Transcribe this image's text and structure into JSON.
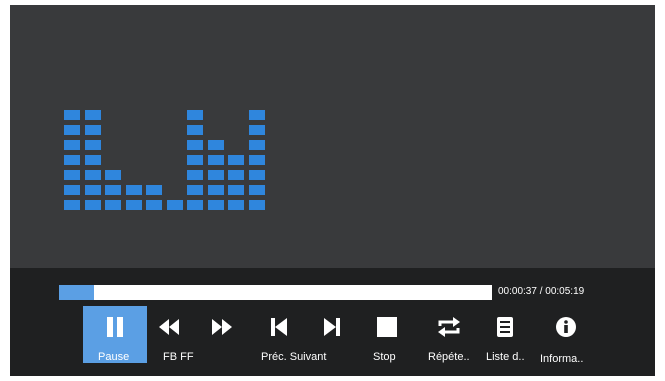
{
  "player": {
    "elapsed": "00:00:37",
    "total": "00:05:19",
    "separator": " / ",
    "progress_fraction": 0.08,
    "accent_color": "#5b9fe4",
    "visualizer_color": "#2f86dd",
    "visualizer_levels": [
      7,
      7,
      3,
      2,
      2,
      1,
      7,
      5,
      4,
      7
    ]
  },
  "controls": {
    "pause": {
      "label": "Pause",
      "icon": "pause-icon"
    },
    "rewind": {
      "icon": "rewind-icon"
    },
    "fast_forward": {
      "icon": "fast-forward-icon"
    },
    "fb_ff_label": "FB FF",
    "previous": {
      "icon": "skip-previous-icon"
    },
    "next": {
      "icon": "skip-next-icon"
    },
    "prev_next_label": "Préc. Suivant",
    "stop": {
      "label": "Stop",
      "icon": "stop-icon"
    },
    "repeat": {
      "label": "Répéte..",
      "icon": "repeat-icon"
    },
    "playlist": {
      "label": "Liste d..",
      "icon": "list-icon"
    },
    "info": {
      "label": "Informa..",
      "icon": "info-icon"
    }
  }
}
